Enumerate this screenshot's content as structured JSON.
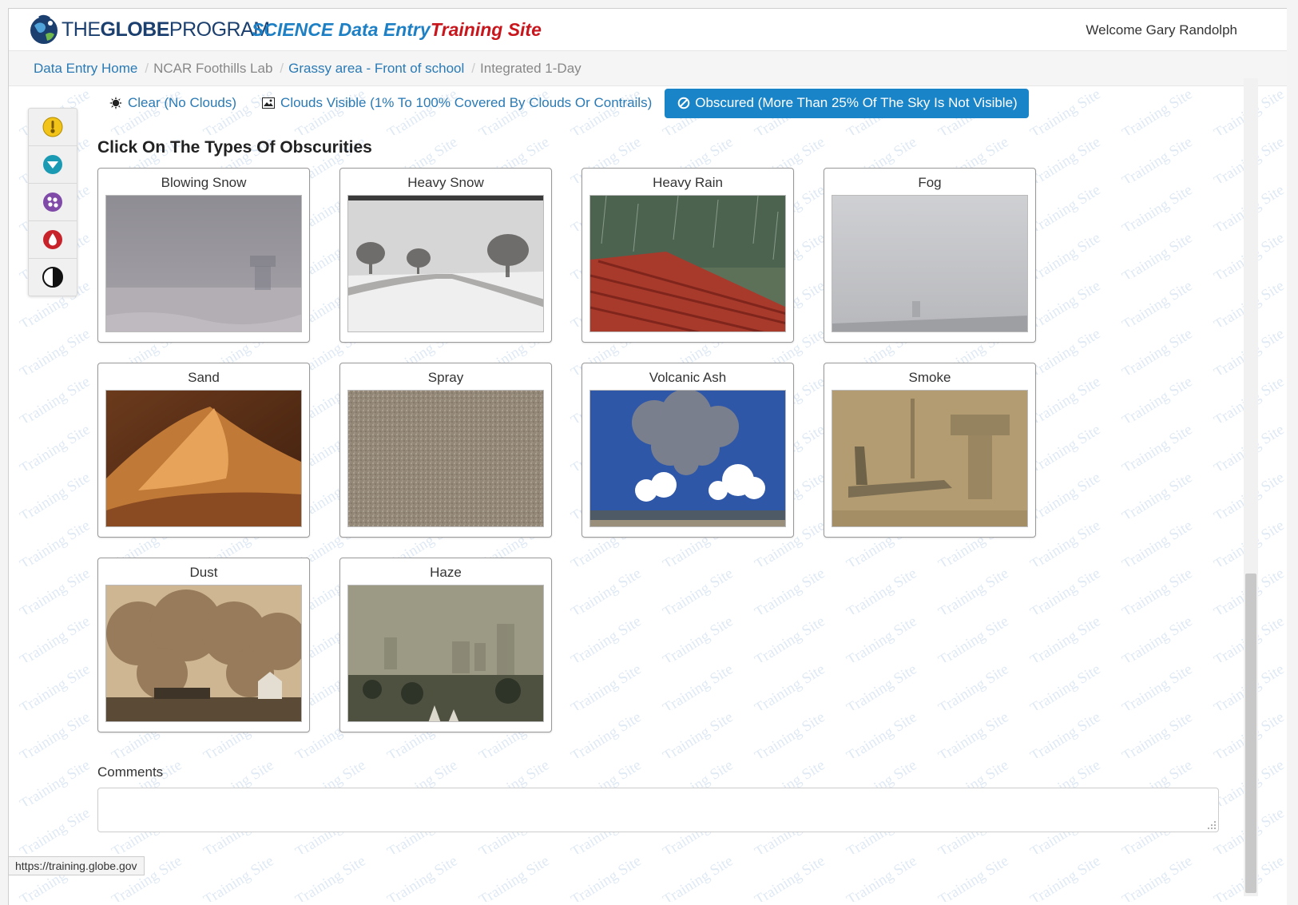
{
  "header": {
    "logo_the": "THE",
    "logo_globe": "GLOBE",
    "logo_program": "PROGRAM",
    "app_title": "SCIENCE Data Entry",
    "training_title": "Training Site",
    "welcome": "Welcome Gary Randolph"
  },
  "breadcrumb": [
    {
      "label": "Data Entry Home",
      "link": true
    },
    {
      "label": "NCAR Foothills Lab",
      "link": false
    },
    {
      "label": "Grassy area - Front of school",
      "link": true
    },
    {
      "label": "Integrated 1-Day",
      "link": false
    }
  ],
  "cloud_options": {
    "clear": "Clear (No Clouds)",
    "visible": "Clouds Visible (1% To 100% Covered By Clouds Or Contrails)",
    "obscured": "Obscured (More Than 25% Of The Sky Is Not Visible)",
    "selected": "obscured"
  },
  "side_toolbar": [
    "thermometer-icon",
    "cloud-cover-icon",
    "precipitation-icon",
    "humidity-icon",
    "surface-icon"
  ],
  "heading": "Click On The Types Of Obscurities",
  "obscurities": [
    "Blowing Snow",
    "Heavy Snow",
    "Heavy Rain",
    "Fog",
    "Sand",
    "Spray",
    "Volcanic Ash",
    "Smoke",
    "Dust",
    "Haze"
  ],
  "comments": {
    "label": "Comments",
    "value": ""
  },
  "status_bar": "https://training.globe.gov",
  "colors": {
    "accent": "#1985c8",
    "link": "#2a7ab5",
    "training_red": "#c8161d"
  }
}
